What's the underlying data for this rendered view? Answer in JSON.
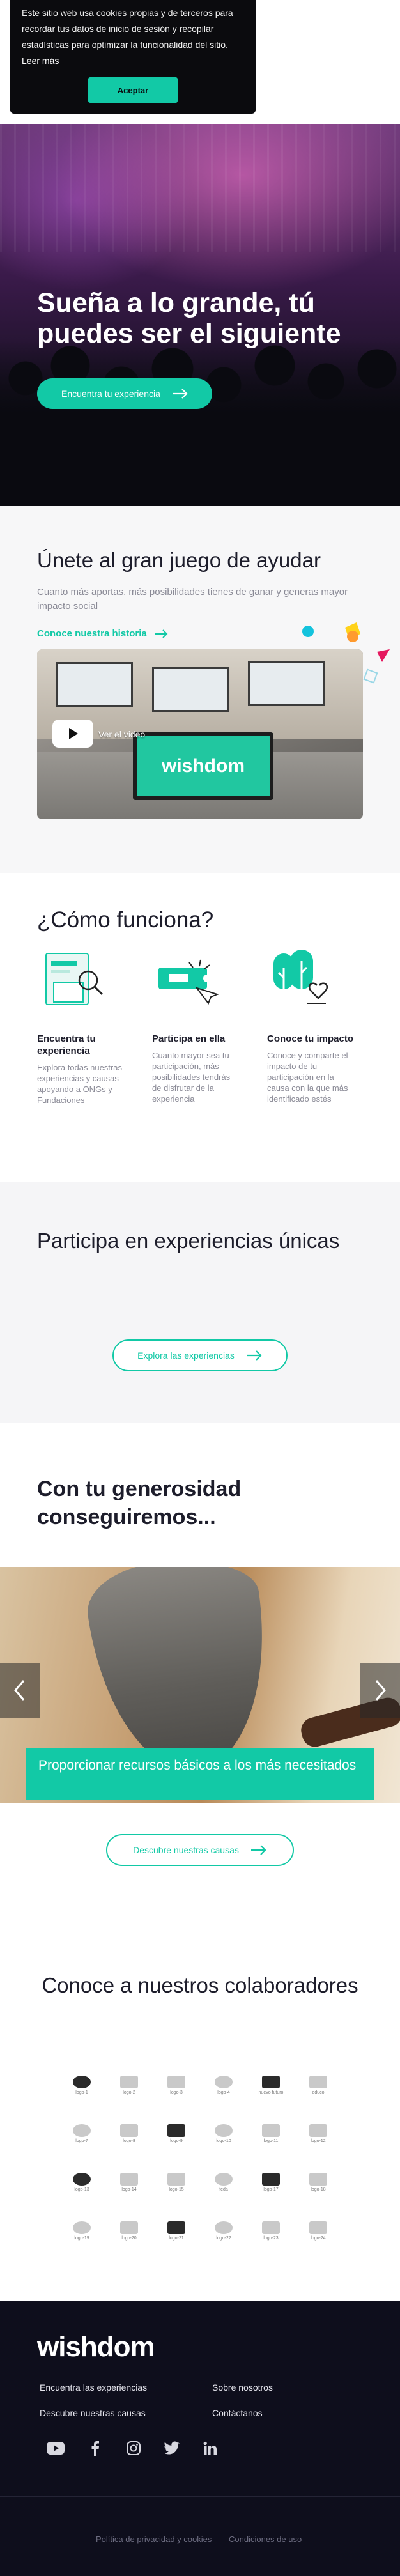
{
  "cookie": {
    "text": "Este sitio web usa cookies propias y de terceros para recordar tus datos de inicio de sesión y recopilar estadísticas para optimizar la funcionalidad del sitio.",
    "link": "Leer más",
    "accept": "Aceptar"
  },
  "hero": {
    "title": "Sueña a lo grande, tú puedes ser el siguiente",
    "cta": "Encuentra tu experiencia"
  },
  "join": {
    "title": "Únete al gran juego de ayudar",
    "lead": "Cuanto más aportas, más posibilidades tienes de ganar y generas mayor impacto social",
    "more": "Conoce nuestra historia",
    "video_label": "Ver el video",
    "video_brand": "wishdom"
  },
  "how": {
    "title": "¿Cómo funciona?",
    "steps": [
      {
        "title": "Encuentra tu experiencia",
        "text": "Explora todas nuestras experiencias y causas apoyando a ONGs y Fundaciones"
      },
      {
        "title": "Participa en ella",
        "text": "Cuanto mayor sea tu participación, más posibilidades tendrás de disfrutar de la experiencia"
      },
      {
        "title": "Conoce tu impacto",
        "text": "Conoce y comparte el impacto de tu participación en la causa con la que más identificado estés"
      }
    ]
  },
  "participa": {
    "title": "Participa en experiencias únicas",
    "button": "Explora las experiencias"
  },
  "generosidad": {
    "title": "Con tu generosidad conseguiremos...",
    "slide_caption": "Proporcionar recursos básicos a los más necesitados",
    "button": "Descubre nuestras causas"
  },
  "collab": {
    "title": "Conoce a nuestros colaboradores",
    "logos": [
      "logo-1",
      "logo-2",
      "logo-3",
      "logo-4",
      "nuevo futuro",
      "educo",
      "logo-7",
      "logo-8",
      "logo-9",
      "logo-10",
      "logo-11",
      "logo-12",
      "logo-13",
      "logo-14",
      "logo-15",
      "feda",
      "logo-17",
      "logo-18",
      "logo-19",
      "logo-20",
      "logo-21",
      "logo-22",
      "logo-23",
      "logo-24"
    ]
  },
  "footer": {
    "brand": "wishdom",
    "links": [
      "Encuentra las experiencias",
      "Sobre nosotros",
      "Descubre nuestras causas",
      "Contáctanos"
    ],
    "legal": [
      "Política de privacidad y cookies",
      "Condiciones de uso"
    ]
  },
  "colors": {
    "accent": "#12c9a6",
    "footer_bg": "#0e0e1c",
    "text": "#1d1d2b"
  }
}
